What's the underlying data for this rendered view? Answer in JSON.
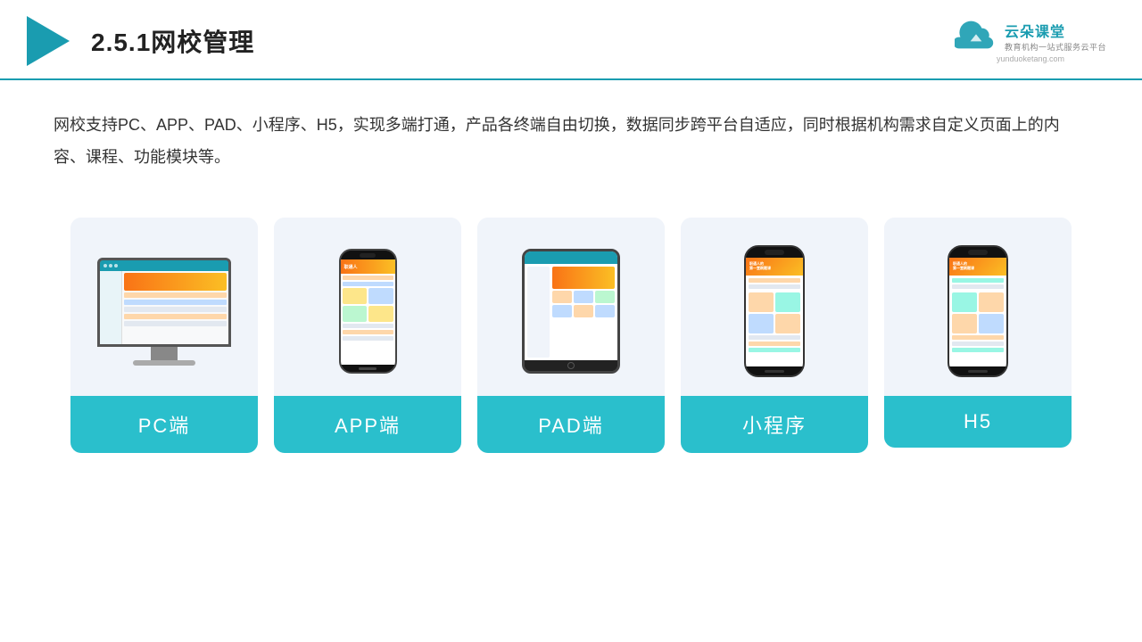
{
  "header": {
    "title": "2.5.1网校管理",
    "logo": {
      "main_text": "云朵课堂",
      "sub_text": "教育机构一站式服务云平台",
      "url": "yunduoketang.com"
    }
  },
  "description": {
    "text": "网校支持PC、APP、PAD、小程序、H5，实现多端打通，产品各终端自由切换，数据同步跨平台自适应，同时根据机构需求自定义页面上的内容、课程、功能模块等。"
  },
  "cards": [
    {
      "id": "pc",
      "label": "PC端",
      "device": "pc"
    },
    {
      "id": "app",
      "label": "APP端",
      "device": "phone"
    },
    {
      "id": "pad",
      "label": "PAD端",
      "device": "tablet"
    },
    {
      "id": "miniprogram",
      "label": "小程序",
      "device": "mini-phone"
    },
    {
      "id": "h5",
      "label": "H5",
      "device": "mini-phone-2"
    }
  ],
  "colors": {
    "accent": "#2abfcc",
    "title_border": "#1a9cb0",
    "card_bg": "#f0f4fa",
    "label_bg": "#2abfcc",
    "label_text": "#ffffff"
  }
}
